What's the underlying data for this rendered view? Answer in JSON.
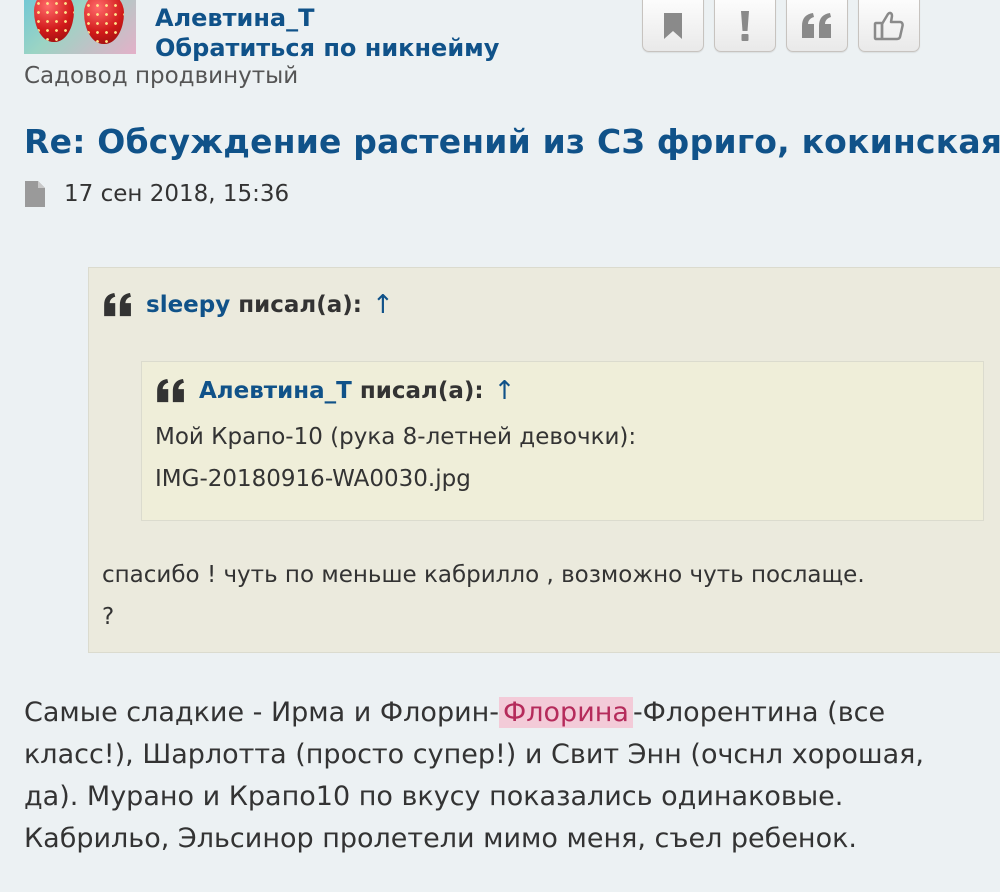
{
  "author": {
    "username": "Алевтина_Т",
    "mention_link": "Обратиться по никнейму",
    "rank": "Садовод продвинутый",
    "avatar": "strawberries-avatar"
  },
  "actions": [
    {
      "name": "bookmark-button",
      "icon": "bookmark-icon"
    },
    {
      "name": "report-button",
      "icon": "exclamation-icon"
    },
    {
      "name": "quote-button",
      "icon": "quote-icon"
    },
    {
      "name": "like-button",
      "icon": "thumbs-up-icon"
    }
  ],
  "post": {
    "title": "Re: Обсуждение растений из СЗ фриго, кокинская",
    "date": "17 сен 2018, 15:36",
    "outer_quote": {
      "author": "sleepy",
      "wrote": "писал(а):",
      "up_arrow": "↑",
      "inner_quote": {
        "author": "Алевтина_Т",
        "wrote": "писал(а):",
        "up_arrow": "↑",
        "line1": "Мой Крапо-10 (рука 8-летней девочки):",
        "attachment": "IMG-20180916-WA0030.jpg"
      },
      "line1": "спасибо ! чуть по меньше кабрилло , возможно чуть послаще.",
      "line2": "?"
    },
    "body": {
      "line1_before": "Самые сладкие - Ирма и Флорин-",
      "line1_highlight": "Флорина",
      "line1_after": "-Флорентина (все",
      "line2": "класс!), Шарлотта (просто супер!) и Свит Энн (очснл хорошая,",
      "line3": "да). Мурано и Крапо10 по вкусу показались одинаковые.",
      "line4": "Кабрильо, Эльсинор пролетели мимо меня, съел ребенок."
    }
  },
  "colors": {
    "background": "#ECF1F3",
    "link": "#105289",
    "quote_bg": "#EBEADD",
    "inner_quote_bg": "#EFEED9",
    "highlight_bg": "#F3CBD8",
    "highlight_text": "#B52B5B"
  }
}
